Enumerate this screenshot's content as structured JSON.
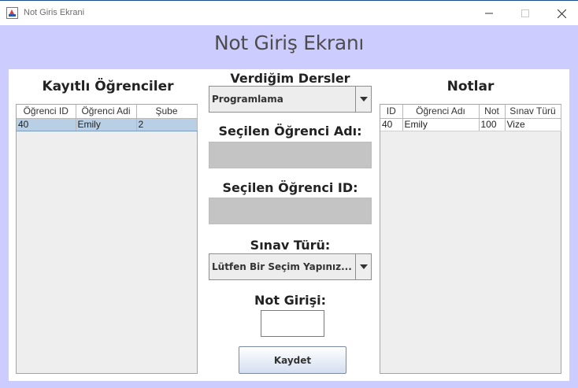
{
  "window": {
    "title": "Not Giris Ekrani"
  },
  "header": {
    "title": "Not Giriş Ekranı"
  },
  "students": {
    "title": "Kayıtlı Öğrenciler",
    "columns": [
      "Öğrenci ID",
      "Öğrenci Adi",
      "Şube"
    ],
    "rows": [
      [
        "40",
        "Emily",
        "2"
      ]
    ]
  },
  "form": {
    "courses_label": "Verdiğim Dersler",
    "course_selected": "Programlama",
    "student_name_label": "Seçilen Öğrenci Adı:",
    "student_name_value": "",
    "student_id_label": "Seçilen Öğrenci ID:",
    "student_id_value": "",
    "exam_type_label": "Sınav Türü:",
    "exam_type_selected": "Lütfen Bir Seçim Yapınız...",
    "grade_label": "Not Girişi:",
    "grade_value": "",
    "save_label": "Kaydet"
  },
  "grades": {
    "title": "Notlar",
    "columns": [
      "ID",
      "Öğrenci Adı",
      "Not",
      "Sınav Türü"
    ],
    "rows": [
      [
        "40",
        "Emily",
        "100",
        "Vize"
      ]
    ]
  }
}
